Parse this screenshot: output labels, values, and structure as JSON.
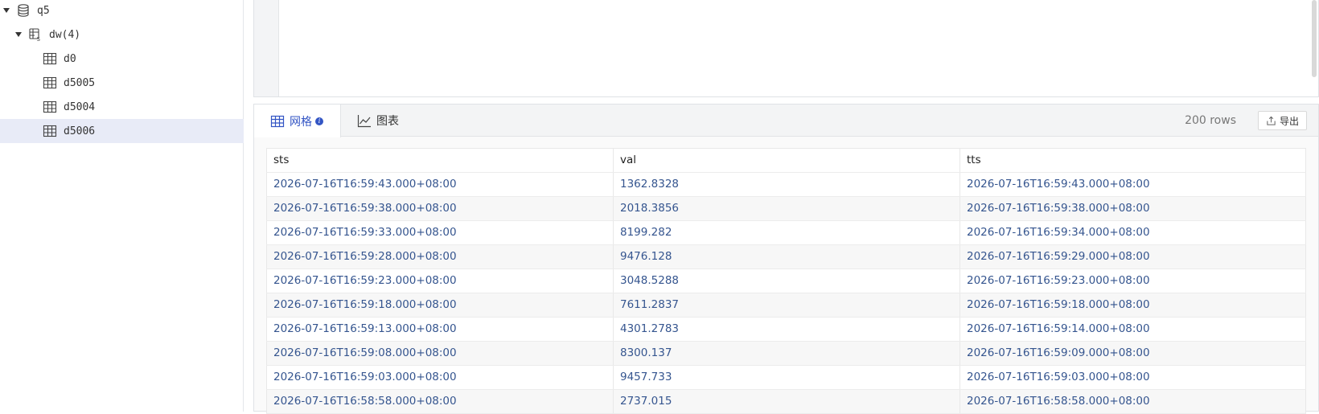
{
  "tree": {
    "items": [
      {
        "label": "q5",
        "icon": "database-icon",
        "indent": 0,
        "expanded": true
      },
      {
        "label": "dw(4)",
        "icon": "schema-icon",
        "indent": 1,
        "expanded": true
      },
      {
        "label": "d0",
        "icon": "table-icon",
        "indent": 2
      },
      {
        "label": "d5005",
        "icon": "table-icon",
        "indent": 2
      },
      {
        "label": "d5004",
        "icon": "table-icon",
        "indent": 2
      },
      {
        "label": "d5006",
        "icon": "table-icon",
        "indent": 2,
        "selected": true
      }
    ]
  },
  "results": {
    "tabs": {
      "grid": {
        "label": "网格",
        "icon": "grid-icon"
      },
      "chart": {
        "label": "图表",
        "icon": "line-chart-icon"
      }
    },
    "row_count": "200 rows",
    "export_label": "导出",
    "columns": [
      "sts",
      "val",
      "tts"
    ],
    "rows": [
      [
        "2026-07-16T16:59:43.000+08:00",
        "1362.8328",
        "2026-07-16T16:59:43.000+08:00"
      ],
      [
        "2026-07-16T16:59:38.000+08:00",
        "2018.3856",
        "2026-07-16T16:59:38.000+08:00"
      ],
      [
        "2026-07-16T16:59:33.000+08:00",
        "8199.282",
        "2026-07-16T16:59:34.000+08:00"
      ],
      [
        "2026-07-16T16:59:28.000+08:00",
        "9476.128",
        "2026-07-16T16:59:29.000+08:00"
      ],
      [
        "2026-07-16T16:59:23.000+08:00",
        "3048.5288",
        "2026-07-16T16:59:23.000+08:00"
      ],
      [
        "2026-07-16T16:59:18.000+08:00",
        "7611.2837",
        "2026-07-16T16:59:18.000+08:00"
      ],
      [
        "2026-07-16T16:59:13.000+08:00",
        "4301.2783",
        "2026-07-16T16:59:14.000+08:00"
      ],
      [
        "2026-07-16T16:59:08.000+08:00",
        "8300.137",
        "2026-07-16T16:59:09.000+08:00"
      ],
      [
        "2026-07-16T16:59:03.000+08:00",
        "9457.733",
        "2026-07-16T16:59:03.000+08:00"
      ],
      [
        "2026-07-16T16:58:58.000+08:00",
        "2737.015",
        "2026-07-16T16:58:58.000+08:00"
      ]
    ]
  },
  "colors": {
    "accent": "#3355c4",
    "cell_text": "#35558f",
    "selected_bg": "#e8ebf7"
  }
}
